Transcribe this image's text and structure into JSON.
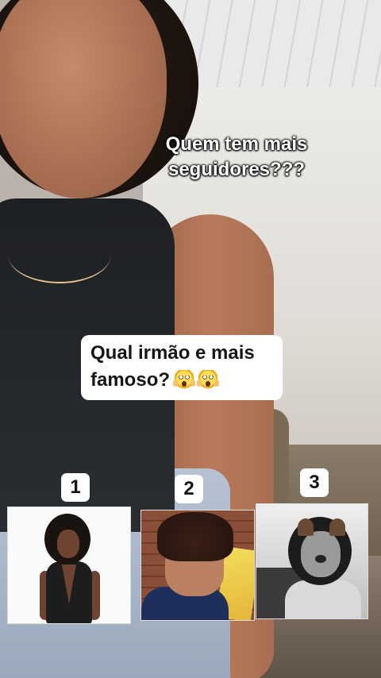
{
  "overlay": {
    "headline_lines": [
      "Quem tem mais",
      "seguidores???"
    ],
    "question_lines": [
      "Qual irmão e mais",
      "famoso?"
    ],
    "question_emoji": [
      "scream-emoji",
      "scream-emoji"
    ]
  },
  "candidates": [
    {
      "number": "1"
    },
    {
      "number": "2"
    },
    {
      "number": "3"
    }
  ]
}
